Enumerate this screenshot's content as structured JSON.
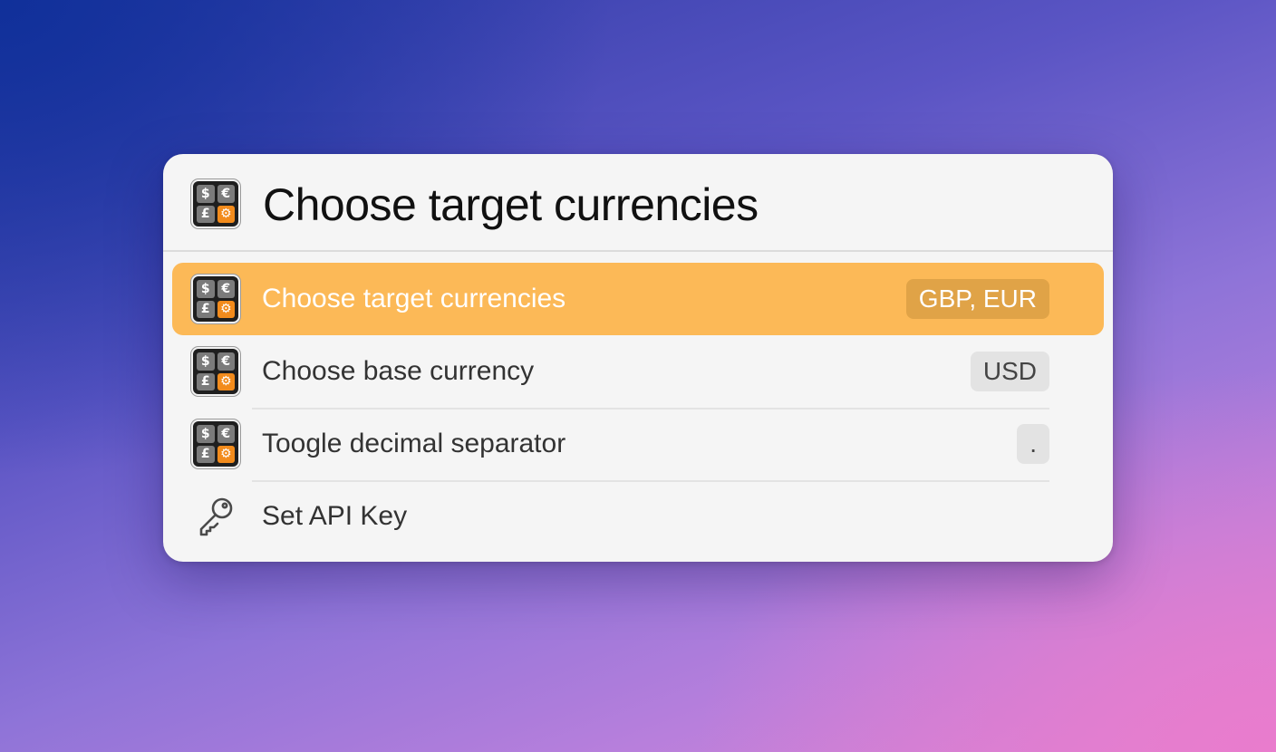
{
  "header": {
    "title": "Choose target currencies",
    "icon": "currency-converter-icon"
  },
  "items": [
    {
      "label": "Choose target currencies",
      "value": "GBP, EUR",
      "icon": "currency-converter-icon",
      "selected": true
    },
    {
      "label": "Choose base currency",
      "value": "USD",
      "icon": "currency-converter-icon",
      "selected": false
    },
    {
      "label": "Toogle decimal separator",
      "value": ".",
      "icon": "currency-converter-icon",
      "selected": false
    },
    {
      "label": "Set API Key",
      "icon": "key-icon",
      "selected": false
    }
  ],
  "icon_glyphs": {
    "dollar": "$",
    "euro": "€",
    "pound": "£",
    "gear": "⚙"
  },
  "colors": {
    "selected_row": "#fcb957",
    "selected_badge": "#e0a347",
    "panel": "#f5f5f5",
    "icon_orange": "#f28b1c"
  }
}
